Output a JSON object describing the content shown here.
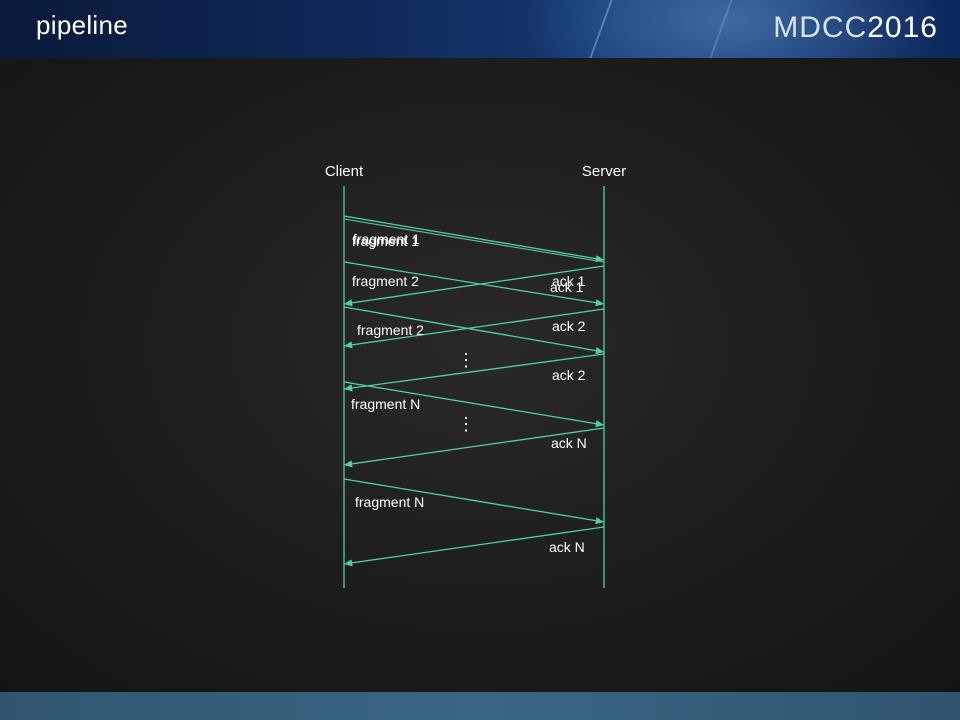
{
  "slide": {
    "title": "pipeline",
    "logo_text": "MDCC",
    "logo_year": "2016"
  },
  "diagram": {
    "client_label": "Client",
    "server_label": "Server",
    "line_color": "#4fd0a8",
    "text_color": "#ffffff",
    "message_labels": {
      "fragment_1a": "fragment 1",
      "fragment_1b": "fragment 1",
      "fragment_2a": "fragment 2",
      "fragment_2b": "fragment 2",
      "fragment_na": "fragment N",
      "fragment_nb": "fragment N",
      "ack_1a": "ack 1",
      "ack_1b": "ack 1",
      "ack_2a": "ack 2",
      "ack_2b": "ack 2",
      "ack_na": "ack N",
      "ack_nb": "ack N"
    },
    "ellipsis": "⋮"
  }
}
